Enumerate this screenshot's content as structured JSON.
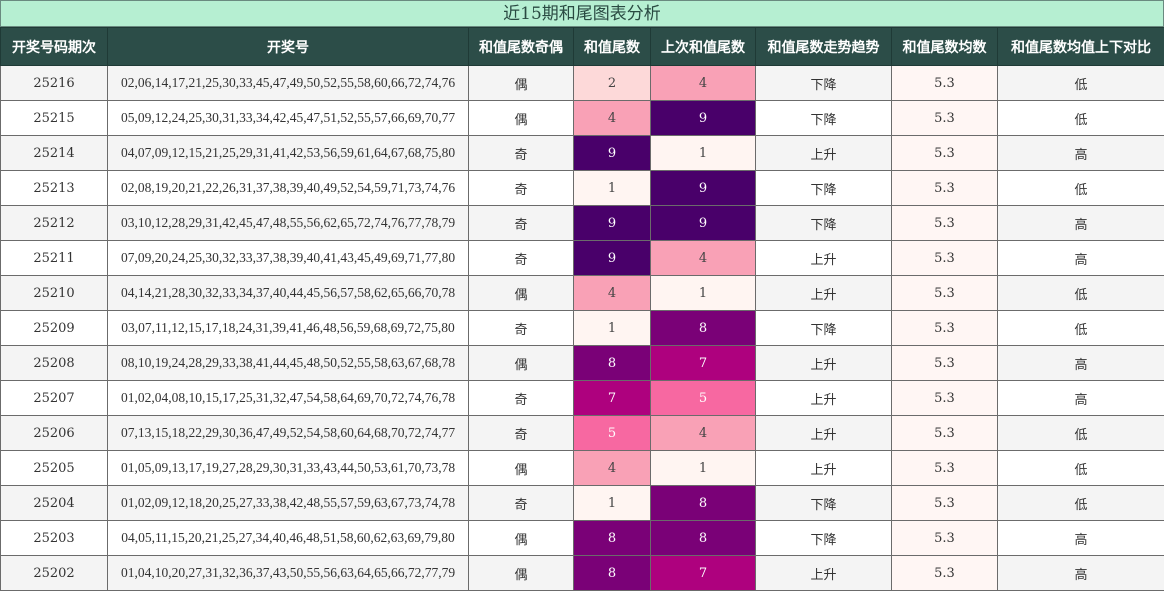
{
  "title": "近15期和尾图表分析",
  "columns": [
    "开奖号码期次",
    "开奖号",
    "和值尾数奇偶",
    "和值尾数",
    "上次和值尾数",
    "和值尾数走势趋势",
    "和值尾数均数",
    "和值尾数均值上下对比"
  ],
  "colors": {
    "title_bg": "#b6efd2",
    "header_bg": "#2c4d48",
    "heat": {
      "1": "#fff5f2",
      "2": "#fdd9d9",
      "4": "#f9a1b6",
      "5": "#f768a1",
      "7": "#ae017e",
      "8": "#7a0177",
      "9": "#49006a"
    }
  },
  "rows": [
    {
      "issue": "25216",
      "numbers": "02,06,14,17,21,25,30,33,45,47,49,50,52,55,58,60,66,72,74,76",
      "parity": "偶",
      "tail": "2",
      "prev_tail": "4",
      "trend": "下降",
      "avg": "5.3",
      "compare": "低"
    },
    {
      "issue": "25215",
      "numbers": "05,09,12,24,25,30,31,33,34,42,45,47,51,52,55,57,66,69,70,77",
      "parity": "偶",
      "tail": "4",
      "prev_tail": "9",
      "trend": "下降",
      "avg": "5.3",
      "compare": "低"
    },
    {
      "issue": "25214",
      "numbers": "04,07,09,12,15,21,25,29,31,41,42,53,56,59,61,64,67,68,75,80",
      "parity": "奇",
      "tail": "9",
      "prev_tail": "1",
      "trend": "上升",
      "avg": "5.3",
      "compare": "高"
    },
    {
      "issue": "25213",
      "numbers": "02,08,19,20,21,22,26,31,37,38,39,40,49,52,54,59,71,73,74,76",
      "parity": "奇",
      "tail": "1",
      "prev_tail": "9",
      "trend": "下降",
      "avg": "5.3",
      "compare": "低"
    },
    {
      "issue": "25212",
      "numbers": "03,10,12,28,29,31,42,45,47,48,55,56,62,65,72,74,76,77,78,79",
      "parity": "奇",
      "tail": "9",
      "prev_tail": "9",
      "trend": "下降",
      "avg": "5.3",
      "compare": "高"
    },
    {
      "issue": "25211",
      "numbers": "07,09,20,24,25,30,32,33,37,38,39,40,41,43,45,49,69,71,77,80",
      "parity": "奇",
      "tail": "9",
      "prev_tail": "4",
      "trend": "上升",
      "avg": "5.3",
      "compare": "高"
    },
    {
      "issue": "25210",
      "numbers": "04,14,21,28,30,32,33,34,37,40,44,45,56,57,58,62,65,66,70,78",
      "parity": "偶",
      "tail": "4",
      "prev_tail": "1",
      "trend": "上升",
      "avg": "5.3",
      "compare": "低"
    },
    {
      "issue": "25209",
      "numbers": "03,07,11,12,15,17,18,24,31,39,41,46,48,56,59,68,69,72,75,80",
      "parity": "奇",
      "tail": "1",
      "prev_tail": "8",
      "trend": "下降",
      "avg": "5.3",
      "compare": "低"
    },
    {
      "issue": "25208",
      "numbers": "08,10,19,24,28,29,33,38,41,44,45,48,50,52,55,58,63,67,68,78",
      "parity": "偶",
      "tail": "8",
      "prev_tail": "7",
      "trend": "上升",
      "avg": "5.3",
      "compare": "高"
    },
    {
      "issue": "25207",
      "numbers": "01,02,04,08,10,15,17,25,31,32,47,54,58,64,69,70,72,74,76,78",
      "parity": "奇",
      "tail": "7",
      "prev_tail": "5",
      "trend": "上升",
      "avg": "5.3",
      "compare": "高"
    },
    {
      "issue": "25206",
      "numbers": "07,13,15,18,22,29,30,36,47,49,52,54,58,60,64,68,70,72,74,77",
      "parity": "奇",
      "tail": "5",
      "prev_tail": "4",
      "trend": "上升",
      "avg": "5.3",
      "compare": "低"
    },
    {
      "issue": "25205",
      "numbers": "01,05,09,13,17,19,27,28,29,30,31,33,43,44,50,53,61,70,73,78",
      "parity": "偶",
      "tail": "4",
      "prev_tail": "1",
      "trend": "上升",
      "avg": "5.3",
      "compare": "低"
    },
    {
      "issue": "25204",
      "numbers": "01,02,09,12,18,20,25,27,33,38,42,48,55,57,59,63,67,73,74,78",
      "parity": "奇",
      "tail": "1",
      "prev_tail": "8",
      "trend": "下降",
      "avg": "5.3",
      "compare": "低"
    },
    {
      "issue": "25203",
      "numbers": "04,05,11,15,20,21,25,27,34,40,46,48,51,58,60,62,63,69,79,80",
      "parity": "偶",
      "tail": "8",
      "prev_tail": "8",
      "trend": "下降",
      "avg": "5.3",
      "compare": "高"
    },
    {
      "issue": "25202",
      "numbers": "01,04,10,20,27,31,32,36,37,43,50,55,56,63,64,65,66,72,77,79",
      "parity": "偶",
      "tail": "8",
      "prev_tail": "7",
      "trend": "上升",
      "avg": "5.3",
      "compare": "高"
    }
  ]
}
